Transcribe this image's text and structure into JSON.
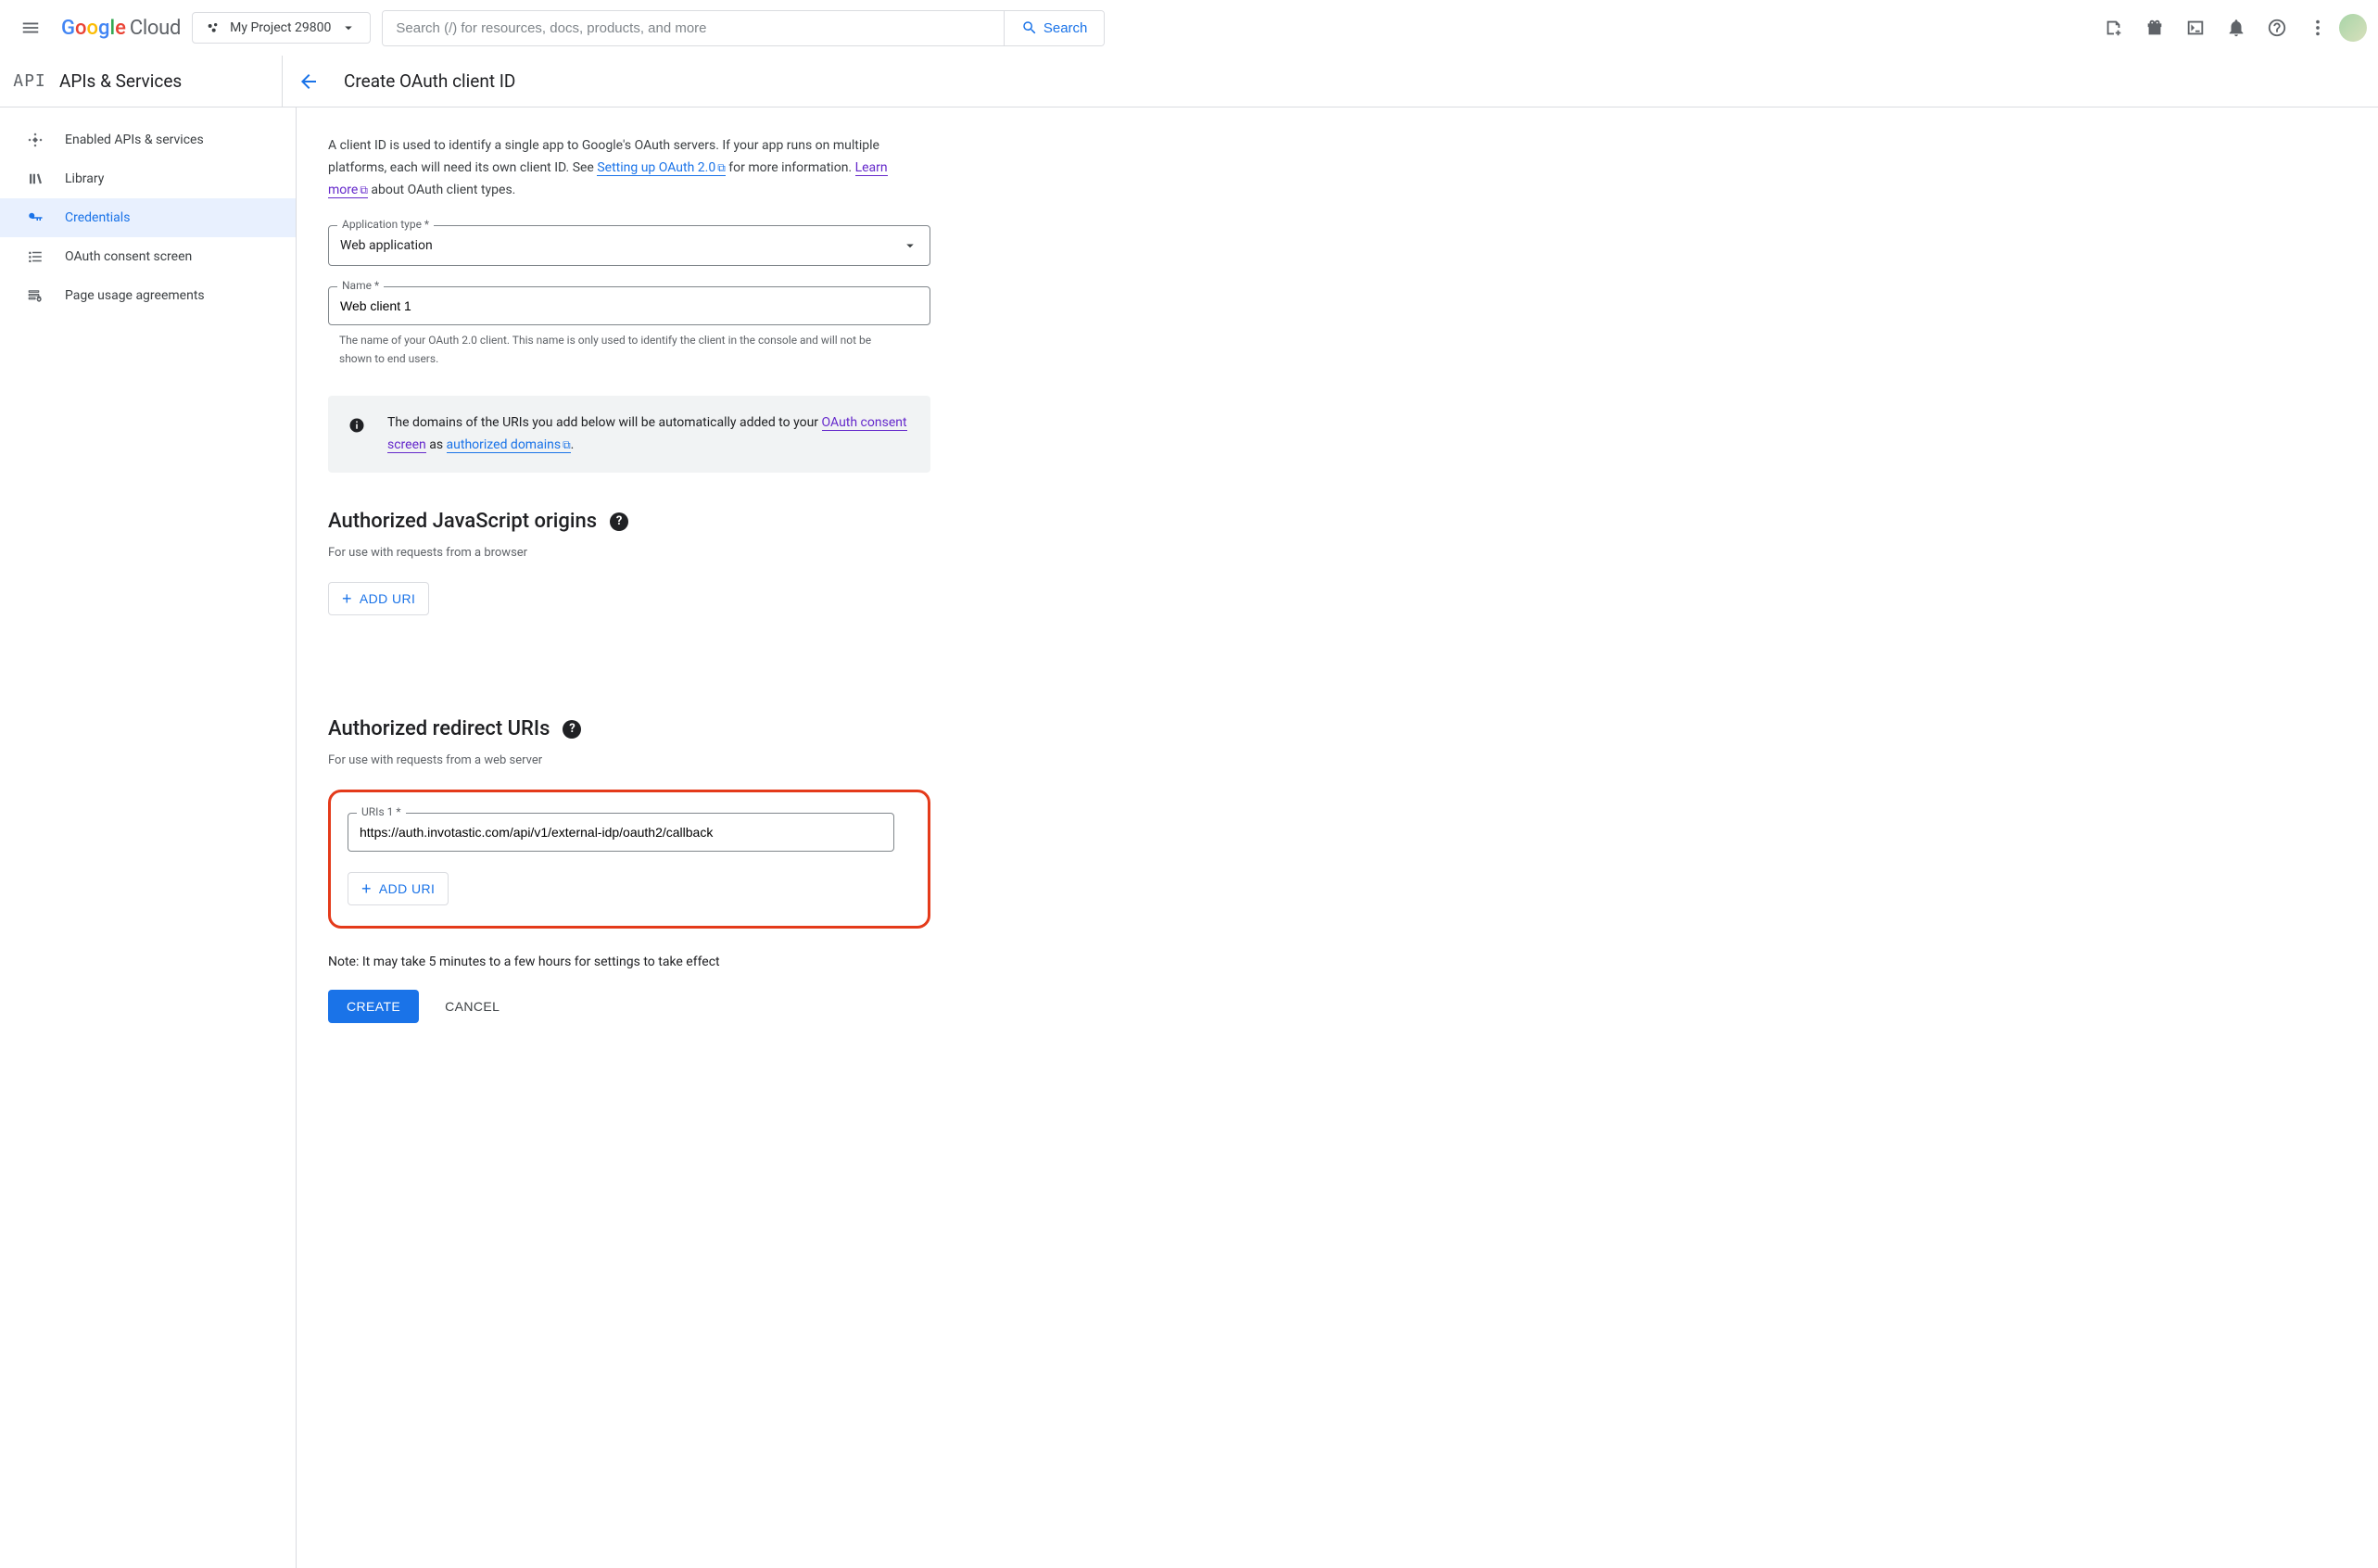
{
  "header": {
    "cloud_word": "Cloud",
    "project_name": "My Project 29800",
    "search_placeholder": "Search (/) for resources, docs, products, and more",
    "search_button": "Search"
  },
  "section": {
    "api_badge": "API",
    "title": "APIs & Services",
    "page_title": "Create OAuth client ID"
  },
  "sidebar": {
    "items": [
      {
        "label": "Enabled APIs & services"
      },
      {
        "label": "Library"
      },
      {
        "label": "Credentials"
      },
      {
        "label": "OAuth consent screen"
      },
      {
        "label": "Page usage agreements"
      }
    ]
  },
  "intro": {
    "p1a": "A client ID is used to identify a single app to Google's OAuth servers. If your app runs on multiple platforms, each will need its own client ID. See ",
    "link1": "Setting up OAuth 2.0",
    "p1b": " for more information. ",
    "link2": "Learn more",
    "p1c": " about OAuth client types."
  },
  "form": {
    "app_type_label": "Application type *",
    "app_type_value": "Web application",
    "name_label": "Name *",
    "name_value": "Web client 1",
    "name_helper": "The name of your OAuth 2.0 client. This name is only used to identify the client in the console and will not be shown to end users.",
    "info_a": "The domains of the URIs you add below will be automatically added to your ",
    "info_link1": "OAuth consent screen",
    "info_b": " as ",
    "info_link2": "authorized domains",
    "info_c": "."
  },
  "js_origins": {
    "title": "Authorized JavaScript origins",
    "sub": "For use with requests from a browser",
    "add_btn": "ADD URI"
  },
  "redirects": {
    "title": "Authorized redirect URIs",
    "sub": "For use with requests from a web server",
    "uri1_label": "URIs 1 *",
    "uri1_value": "https://auth.invotastic.com/api/v1/external-idp/oauth2/callback",
    "add_btn": "ADD URI"
  },
  "footer": {
    "note": "Note: It may take 5 minutes to a few hours for settings to take effect",
    "create": "CREATE",
    "cancel": "CANCEL"
  }
}
